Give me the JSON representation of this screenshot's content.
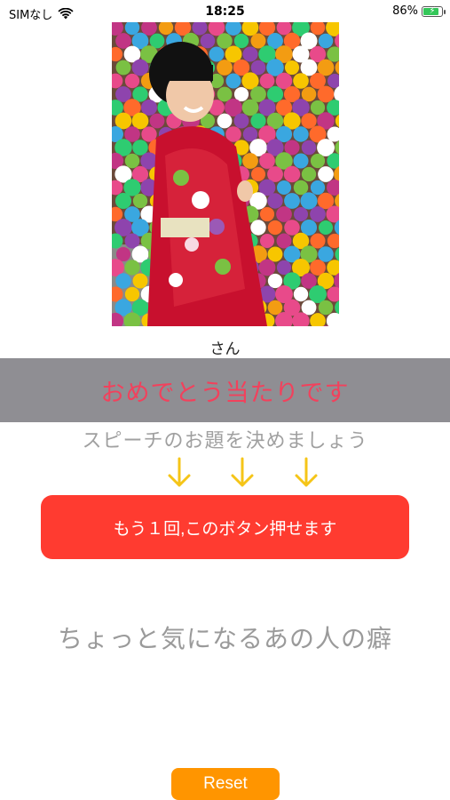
{
  "status_bar": {
    "carrier": "SIMなし",
    "time": "18:25",
    "battery_percent": "86%",
    "battery_level": 0.86,
    "icons": [
      "wifi-icon",
      "battery-charging-icon"
    ]
  },
  "photo": {
    "kind": "photo of a child in a red kimono in front of colorful knit balls"
  },
  "name_label": "さん",
  "banner": {
    "text": "おめでとう当たりです"
  },
  "subtitle": "スピーチのお題を決めましょう",
  "arrows": {
    "icon": "arrow-down-icon",
    "color": "#f5c518",
    "count": 3
  },
  "main_button": {
    "label": "もう１回,このボタン押せます"
  },
  "topic": "ちょっと気になるあの人の癖",
  "reset_button": {
    "label": "Reset"
  },
  "colors": {
    "banner_bg": "#8f8e93",
    "banner_text": "#f2415c",
    "main_button": "#ff3b30",
    "reset_button": "#ff9500",
    "muted_text": "#9a9a9a"
  }
}
